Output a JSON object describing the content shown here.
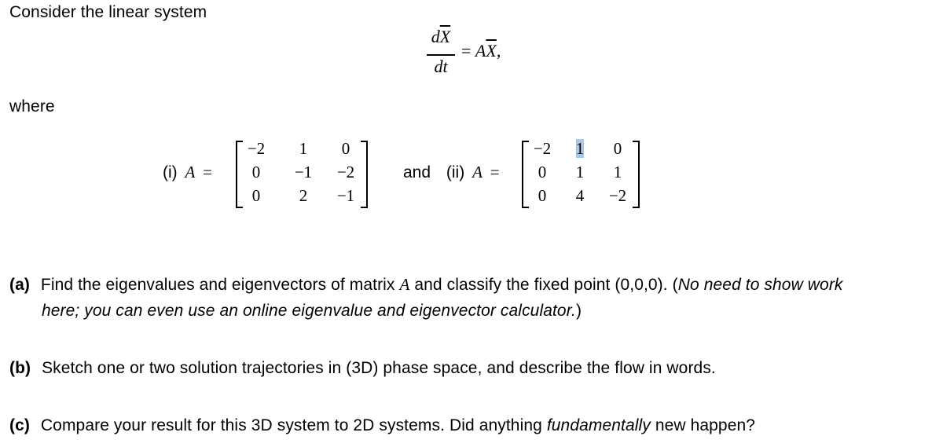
{
  "intro": "Consider the linear system",
  "equation": {
    "numerator": "dX̄",
    "numerator_d": "d",
    "numerator_var": "X",
    "denominator": "dt",
    "equals": "=",
    "rhs_matrix": "A",
    "rhs_var": "X",
    "trailing": ","
  },
  "where": "where",
  "matrices": [
    {
      "label": "(i)",
      "symbol": "A",
      "equals": "=",
      "rows": [
        [
          "−2",
          "1",
          "0"
        ],
        [
          "0",
          "−1",
          "−2"
        ],
        [
          "0",
          "2",
          "−1"
        ]
      ]
    },
    {
      "connector": "and",
      "label": "(ii)",
      "symbol": "A",
      "equals": "=",
      "rows": [
        [
          "−2",
          "1",
          "0"
        ],
        [
          "0",
          "1",
          "1"
        ],
        [
          "0",
          "4",
          "−2"
        ]
      ],
      "highlighted_cell": "row 1, column 2"
    }
  ],
  "questions": [
    {
      "label": "(a)",
      "line1_pre": "Find the eigenvalues and eigenvectors of matrix ",
      "line1_var": "A",
      "line1_post": " and classify the fixed point (0,0,0). (",
      "line1_italic": "No need to show work",
      "line2_italic": "here; you can even use an online eigenvalue and eigenvector calculator.",
      "line2_post": ")"
    },
    {
      "label": "(b)",
      "text": "Sketch one or two solution trajectories in (3D) phase space, and describe the flow in words."
    },
    {
      "label": "(c)",
      "text_pre": "Compare your result for this 3D system to 2D systems. Did anything ",
      "text_italic": "fundamentally",
      "text_post": " new happen?"
    }
  ],
  "colors": {
    "text": "#000000",
    "selection_highlight": "#a8c8e8"
  }
}
